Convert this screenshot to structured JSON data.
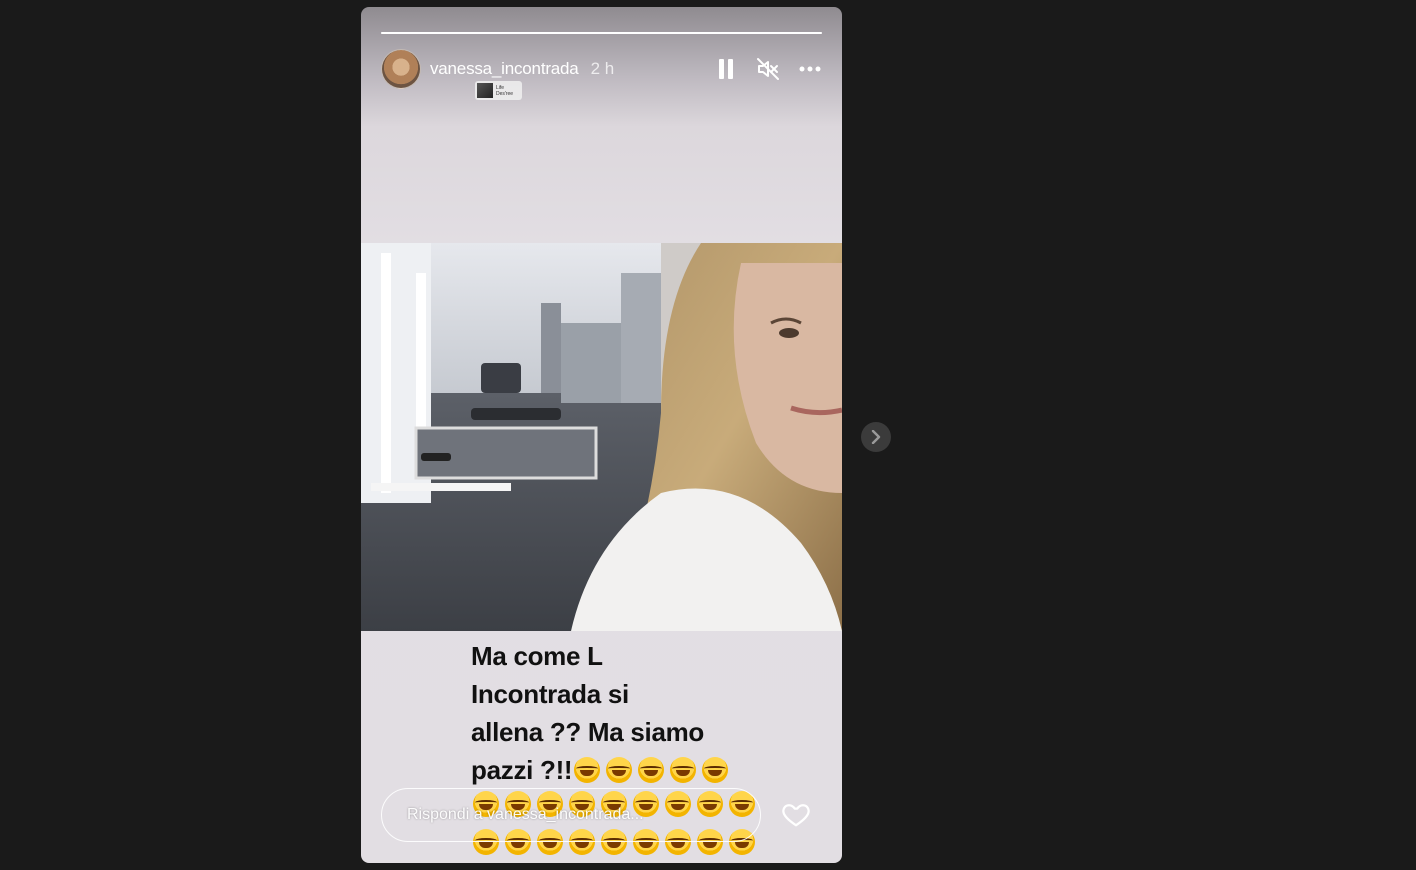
{
  "story": {
    "username": "vanessa_incontrada",
    "timestamp": "2 h",
    "progress_fraction": 1.0,
    "music_sticker": {
      "line1": "Life",
      "line2": "Des'ree"
    },
    "caption_lines": [
      "Ma come L",
      "Incontrada si",
      "allena ?? Ma siamo",
      "pazzi ?!!"
    ],
    "emoji": "laughing-tears-emoji",
    "emoji_counts": {
      "line_4": 5,
      "row_2": 9,
      "row_3": 9
    }
  },
  "reply": {
    "placeholder": "Rispondi a vanessa_incontrada..."
  },
  "icons": {
    "pause": "pause-icon",
    "mute": "muted-speaker-icon",
    "more": "more-icon",
    "like": "heart-icon",
    "next": "chevron-right-icon"
  },
  "colors": {
    "background": "#1a1a1a",
    "text": "#ffffff",
    "caption": "#111111"
  }
}
